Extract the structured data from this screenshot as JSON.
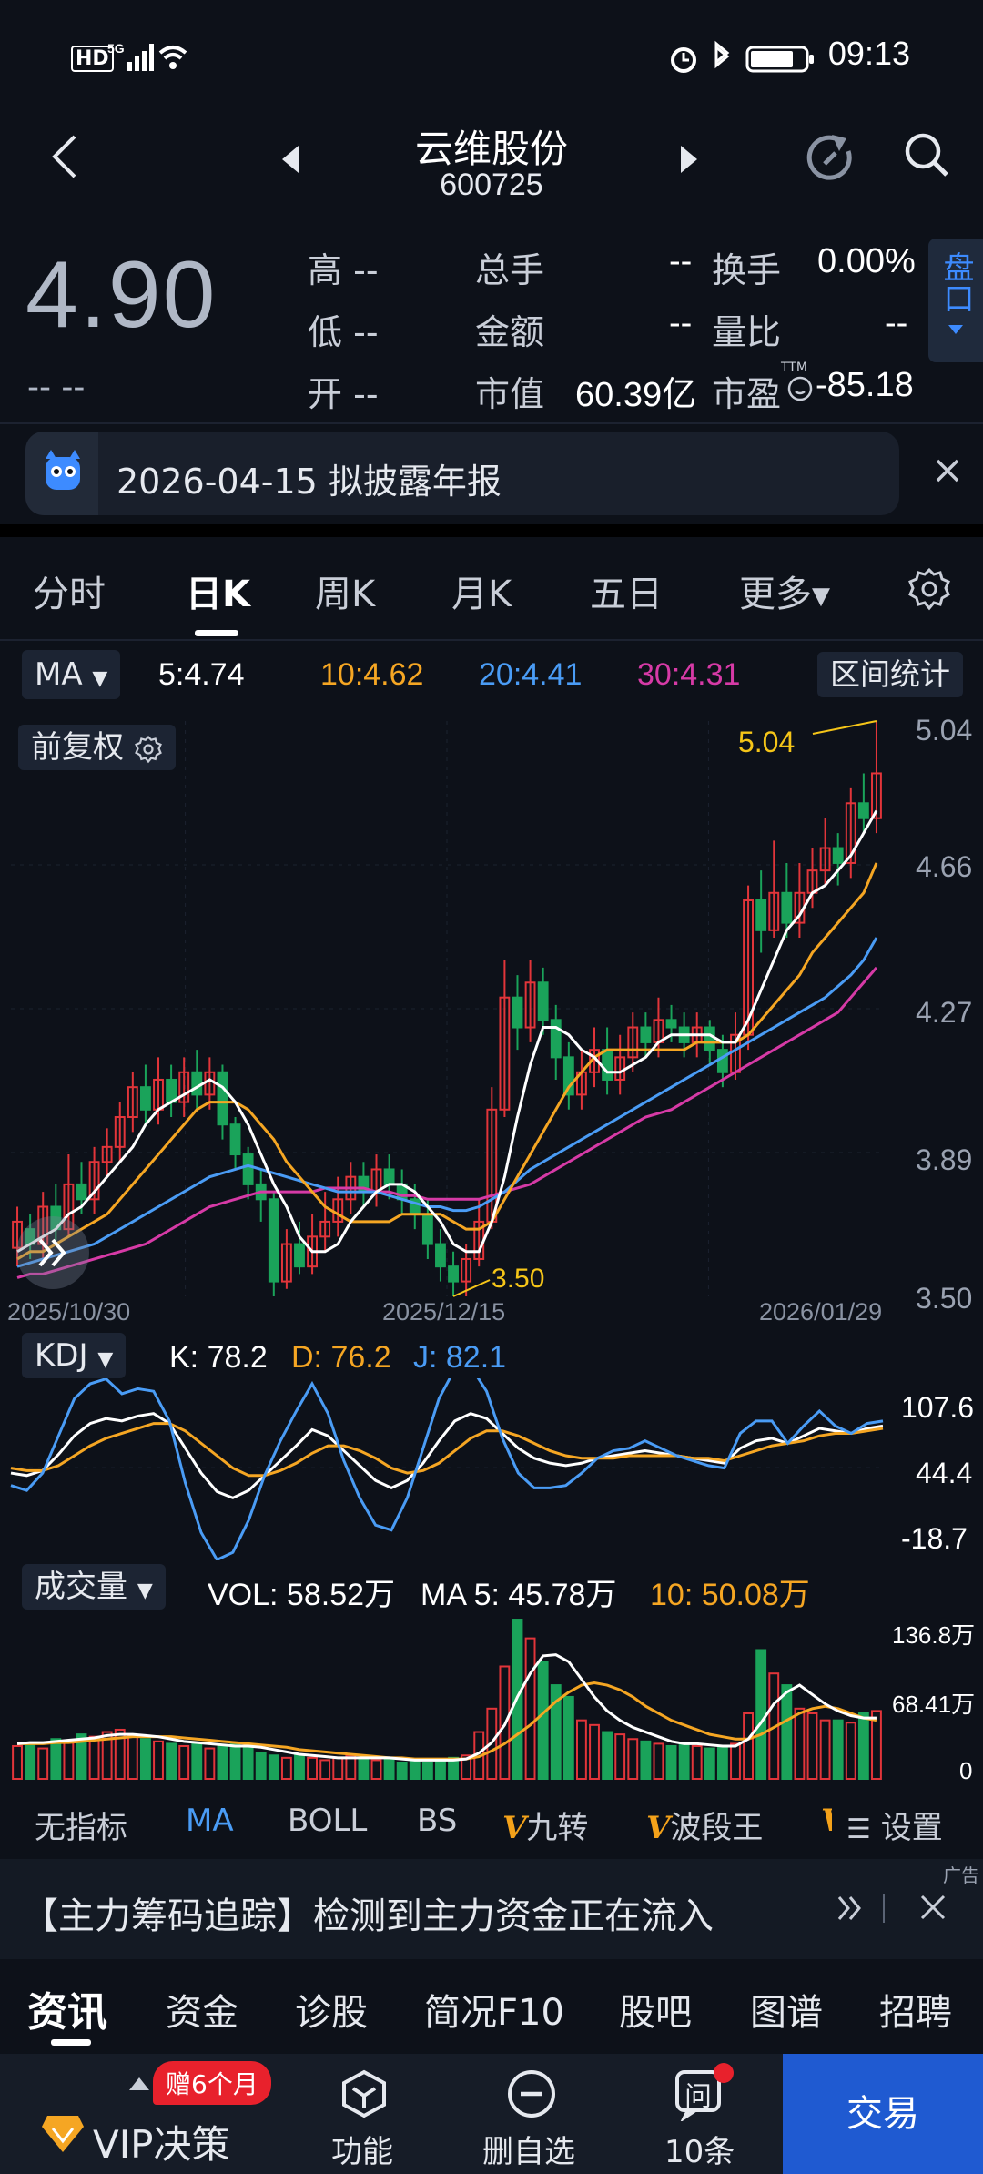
{
  "status": {
    "time": "09:13",
    "hd": "HD",
    "net": "5G"
  },
  "header": {
    "stock_name": "云维股份",
    "stock_code": "600725"
  },
  "quote": {
    "price": "4.90",
    "change": "-- --",
    "high_label": "高",
    "high": "--",
    "low_label": "低",
    "low": "--",
    "open_label": "开",
    "open": "--",
    "vol_label": "总手",
    "vol": "--",
    "amount_label": "金额",
    "amount": "--",
    "mcap_label": "市值",
    "mcap": "60.39亿",
    "turnover_label": "换手",
    "turnover": "0.00%",
    "ratio_label": "量比",
    "ratio": "--",
    "pe_label": "市盈",
    "pe_sup": "TTM",
    "pe": "-85.18",
    "pankou": "盘口"
  },
  "notice": {
    "text": "2026-04-15 拟披露年报"
  },
  "period_tabs": [
    "分时",
    "日K",
    "周K",
    "月K",
    "五日",
    "更多"
  ],
  "ma_bar": {
    "selector": "MA",
    "ma5": "5:4.74",
    "ma10": "10:4.62",
    "ma20": "20:4.41",
    "ma30": "30:4.31",
    "range_btn": "区间统计"
  },
  "adjust_btn": "前复权",
  "colors": {
    "up": "#e2353a",
    "down": "#1aa35a",
    "ma5": "#ffffff",
    "ma10": "#f5a623",
    "ma20": "#4a9cf5",
    "ma30": "#d63aa6",
    "accent": "#1f5ad1"
  },
  "chart_data": [
    {
      "type": "candlestick",
      "y_ticks": [
        "5.04",
        "4.66",
        "4.27",
        "3.89",
        "3.50"
      ],
      "ylim": [
        3.5,
        5.04
      ],
      "x_ticks": [
        "2025/10/30",
        "2025/12/15",
        "2026/01/29"
      ],
      "annotations": {
        "max": "5.04",
        "min": "3.50"
      },
      "candles": [
        [
          3.63,
          3.7,
          3.58,
          3.74
        ],
        [
          3.68,
          3.64,
          3.6,
          3.72
        ],
        [
          3.64,
          3.74,
          3.6,
          3.78
        ],
        [
          3.74,
          3.68,
          3.65,
          3.8
        ],
        [
          3.68,
          3.8,
          3.66,
          3.88
        ],
        [
          3.8,
          3.76,
          3.72,
          3.86
        ],
        [
          3.76,
          3.86,
          3.72,
          3.9
        ],
        [
          3.86,
          3.9,
          3.82,
          3.95
        ],
        [
          3.9,
          3.98,
          3.86,
          4.02
        ],
        [
          3.98,
          4.06,
          3.94,
          4.1
        ],
        [
          4.06,
          4.0,
          3.96,
          4.12
        ],
        [
          4.0,
          4.08,
          3.96,
          4.14
        ],
        [
          4.08,
          4.02,
          3.98,
          4.12
        ],
        [
          4.02,
          4.1,
          3.98,
          4.14
        ],
        [
          4.1,
          4.04,
          4.0,
          4.16
        ],
        [
          4.04,
          4.1,
          4.0,
          4.14
        ],
        [
          4.1,
          3.96,
          3.92,
          4.12
        ],
        [
          3.96,
          3.88,
          3.84,
          3.98
        ],
        [
          3.88,
          3.8,
          3.76,
          3.9
        ],
        [
          3.8,
          3.76,
          3.7,
          3.84
        ],
        [
          3.76,
          3.54,
          3.5,
          3.78
        ],
        [
          3.54,
          3.64,
          3.52,
          3.68
        ],
        [
          3.64,
          3.58,
          3.56,
          3.7
        ],
        [
          3.58,
          3.66,
          3.56,
          3.72
        ],
        [
          3.66,
          3.7,
          3.62,
          3.78
        ],
        [
          3.7,
          3.76,
          3.66,
          3.82
        ],
        [
          3.76,
          3.82,
          3.72,
          3.86
        ],
        [
          3.82,
          3.78,
          3.74,
          3.86
        ],
        [
          3.78,
          3.84,
          3.74,
          3.88
        ],
        [
          3.84,
          3.8,
          3.76,
          3.88
        ],
        [
          3.8,
          3.76,
          3.72,
          3.84
        ],
        [
          3.76,
          3.72,
          3.68,
          3.8
        ],
        [
          3.72,
          3.64,
          3.6,
          3.76
        ],
        [
          3.64,
          3.58,
          3.54,
          3.68
        ],
        [
          3.58,
          3.54,
          3.5,
          3.62
        ],
        [
          3.54,
          3.6,
          3.5,
          3.64
        ],
        [
          3.6,
          3.7,
          3.58,
          3.76
        ],
        [
          3.7,
          4.0,
          3.68,
          4.06
        ],
        [
          4.0,
          4.3,
          3.98,
          4.4
        ],
        [
          4.3,
          4.22,
          4.16,
          4.36
        ],
        [
          4.22,
          4.34,
          4.18,
          4.4
        ],
        [
          4.34,
          4.24,
          4.2,
          4.38
        ],
        [
          4.24,
          4.14,
          4.08,
          4.28
        ],
        [
          4.14,
          4.04,
          4.0,
          4.18
        ],
        [
          4.04,
          4.1,
          4.0,
          4.16
        ],
        [
          4.1,
          4.16,
          4.06,
          4.22
        ],
        [
          4.16,
          4.08,
          4.04,
          4.22
        ],
        [
          4.08,
          4.14,
          4.04,
          4.2
        ],
        [
          4.14,
          4.22,
          4.1,
          4.26
        ],
        [
          4.22,
          4.18,
          4.14,
          4.26
        ],
        [
          4.18,
          4.24,
          4.14,
          4.3
        ],
        [
          4.24,
          4.22,
          4.18,
          4.28
        ],
        [
          4.22,
          4.18,
          4.14,
          4.26
        ],
        [
          4.18,
          4.22,
          4.14,
          4.26
        ],
        [
          4.22,
          4.16,
          4.12,
          4.24
        ],
        [
          4.16,
          4.1,
          4.06,
          4.2
        ],
        [
          4.1,
          4.2,
          4.08,
          4.26
        ],
        [
          4.2,
          4.56,
          4.16,
          4.6
        ],
        [
          4.56,
          4.48,
          4.42,
          4.64
        ],
        [
          4.48,
          4.58,
          4.46,
          4.72
        ],
        [
          4.58,
          4.5,
          4.46,
          4.66
        ],
        [
          4.5,
          4.58,
          4.46,
          4.66
        ],
        [
          4.58,
          4.64,
          4.54,
          4.7
        ],
        [
          4.64,
          4.7,
          4.6,
          4.78
        ],
        [
          4.7,
          4.66,
          4.6,
          4.74
        ],
        [
          4.66,
          4.82,
          4.62,
          4.86
        ],
        [
          4.82,
          4.78,
          4.74,
          4.9
        ],
        [
          4.78,
          4.9,
          4.74,
          5.04
        ]
      ],
      "ma5": [
        3.62,
        3.64,
        3.66,
        3.68,
        3.72,
        3.74,
        3.78,
        3.82,
        3.86,
        3.9,
        3.96,
        4.0,
        4.02,
        4.04,
        4.06,
        4.08,
        4.06,
        4.02,
        3.96,
        3.88,
        3.8,
        3.74,
        3.66,
        3.62,
        3.62,
        3.64,
        3.7,
        3.74,
        3.78,
        3.8,
        3.8,
        3.78,
        3.74,
        3.7,
        3.64,
        3.62,
        3.62,
        3.7,
        3.82,
        3.98,
        4.12,
        4.22,
        4.22,
        4.2,
        4.16,
        4.14,
        4.1,
        4.1,
        4.12,
        4.14,
        4.18,
        4.2,
        4.2,
        4.2,
        4.2,
        4.18,
        4.18,
        4.24,
        4.32,
        4.4,
        4.48,
        4.52,
        4.58,
        4.6,
        4.64,
        4.68,
        4.74,
        4.8
      ],
      "ma10": [
        3.6,
        3.62,
        3.62,
        3.64,
        3.66,
        3.68,
        3.7,
        3.72,
        3.76,
        3.8,
        3.84,
        3.88,
        3.92,
        3.96,
        4.0,
        4.02,
        4.02,
        4.02,
        4.0,
        3.96,
        3.92,
        3.86,
        3.82,
        3.78,
        3.74,
        3.72,
        3.7,
        3.7,
        3.7,
        3.7,
        3.72,
        3.72,
        3.72,
        3.72,
        3.7,
        3.68,
        3.68,
        3.7,
        3.76,
        3.82,
        3.88,
        3.94,
        4.0,
        4.06,
        4.1,
        4.14,
        4.16,
        4.16,
        4.16,
        4.16,
        4.16,
        4.16,
        4.16,
        4.18,
        4.18,
        4.18,
        4.18,
        4.2,
        4.24,
        4.28,
        4.32,
        4.36,
        4.42,
        4.46,
        4.5,
        4.54,
        4.58,
        4.66
      ],
      "ma20": [
        3.58,
        3.59,
        3.6,
        3.61,
        3.62,
        3.63,
        3.64,
        3.66,
        3.68,
        3.7,
        3.72,
        3.74,
        3.76,
        3.78,
        3.8,
        3.82,
        3.83,
        3.84,
        3.85,
        3.84,
        3.83,
        3.82,
        3.81,
        3.8,
        3.79,
        3.78,
        3.78,
        3.78,
        3.78,
        3.77,
        3.76,
        3.75,
        3.74,
        3.74,
        3.73,
        3.73,
        3.74,
        3.76,
        3.78,
        3.81,
        3.84,
        3.86,
        3.88,
        3.9,
        3.92,
        3.94,
        3.96,
        3.98,
        4.0,
        4.02,
        4.04,
        4.06,
        4.08,
        4.1,
        4.12,
        4.14,
        4.16,
        4.18,
        4.2,
        4.22,
        4.24,
        4.26,
        4.28,
        4.3,
        4.33,
        4.36,
        4.4,
        4.46
      ],
      "ma30": [
        3.55,
        3.56,
        3.56,
        3.57,
        3.58,
        3.59,
        3.6,
        3.61,
        3.62,
        3.63,
        3.64,
        3.66,
        3.68,
        3.7,
        3.72,
        3.74,
        3.75,
        3.76,
        3.77,
        3.78,
        3.78,
        3.78,
        3.78,
        3.78,
        3.79,
        3.79,
        3.79,
        3.79,
        3.78,
        3.78,
        3.77,
        3.77,
        3.76,
        3.76,
        3.76,
        3.76,
        3.76,
        3.77,
        3.78,
        3.79,
        3.8,
        3.82,
        3.84,
        3.86,
        3.88,
        3.9,
        3.92,
        3.94,
        3.96,
        3.98,
        3.99,
        4.0,
        4.02,
        4.04,
        4.06,
        4.08,
        4.1,
        4.12,
        4.14,
        4.16,
        4.18,
        4.2,
        4.22,
        4.24,
        4.26,
        4.3,
        4.34,
        4.38
      ]
    },
    {
      "type": "line",
      "name": "KDJ",
      "y_ticks": [
        "107.6",
        "44.4",
        "-18.7"
      ],
      "ylim": [
        -18.7,
        107.6
      ],
      "legend": {
        "k": "K: 78.2",
        "d": "D: 76.2",
        "j": "J: 82.1"
      },
      "series": [
        {
          "name": "K",
          "values": [
            40,
            38,
            42,
            55,
            70,
            80,
            84,
            82,
            86,
            88,
            80,
            60,
            40,
            25,
            20,
            26,
            38,
            50,
            62,
            75,
            70,
            58,
            46,
            34,
            28,
            34,
            48,
            66,
            82,
            88,
            84,
            72,
            60,
            52,
            48,
            46,
            48,
            52,
            54,
            56,
            58,
            56,
            54,
            52,
            50,
            48,
            60,
            66,
            68,
            64,
            70,
            76,
            74,
            72,
            76,
            78
          ]
        },
        {
          "name": "D",
          "values": [
            44,
            42,
            42,
            46,
            54,
            62,
            68,
            72,
            76,
            80,
            80,
            74,
            64,
            54,
            44,
            38,
            38,
            42,
            48,
            56,
            62,
            62,
            58,
            52,
            44,
            40,
            42,
            48,
            58,
            68,
            74,
            74,
            70,
            64,
            58,
            54,
            52,
            52,
            52,
            54,
            54,
            54,
            54,
            52,
            52,
            50,
            54,
            58,
            62,
            64,
            66,
            70,
            72,
            72,
            74,
            76
          ]
        },
        {
          "name": "J",
          "values": [
            30,
            26,
            40,
            70,
            100,
            112,
            116,
            104,
            108,
            106,
            82,
            32,
            -8,
            -30,
            -24,
            2,
            38,
            66,
            90,
            112,
            88,
            50,
            20,
            -2,
            -6,
            20,
            60,
            100,
            124,
            126,
            106,
            68,
            40,
            28,
            28,
            30,
            40,
            52,
            58,
            60,
            66,
            60,
            54,
            50,
            46,
            44,
            72,
            82,
            82,
            64,
            78,
            90,
            78,
            72,
            80,
            82
          ]
        }
      ]
    },
    {
      "type": "bar",
      "name": "成交量",
      "y_ticks": [
        "136.8万",
        "68.41万",
        "0"
      ],
      "ylim": [
        0,
        136.8
      ],
      "legend": {
        "vol": "VOL: 58.52万",
        "ma5": "MA 5: 45.78万",
        "ma10": "10: 50.08万"
      },
      "values": [
        28,
        30,
        26,
        34,
        32,
        38,
        36,
        40,
        42,
        36,
        34,
        32,
        30,
        28,
        30,
        26,
        28,
        30,
        26,
        22,
        20,
        18,
        20,
        18,
        16,
        18,
        20,
        18,
        16,
        18,
        14,
        16,
        14,
        16,
        18,
        20,
        40,
        60,
        96,
        136,
        120,
        100,
        80,
        70,
        50,
        46,
        40,
        38,
        34,
        32,
        30,
        28,
        30,
        28,
        26,
        28,
        30,
        56,
        110,
        90,
        80,
        60,
        56,
        50,
        50,
        48,
        56,
        58
      ],
      "ma5": [
        30,
        31,
        31,
        32,
        33,
        34,
        35,
        37,
        38,
        38,
        37,
        36,
        34,
        32,
        31,
        30,
        29,
        28,
        28,
        27,
        25,
        23,
        21,
        20,
        19,
        18,
        18,
        18,
        18,
        18,
        17,
        16,
        16,
        16,
        16,
        17,
        22,
        31,
        46,
        70,
        90,
        105,
        106,
        100,
        85,
        70,
        58,
        50,
        44,
        40,
        36,
        32,
        30,
        30,
        29,
        28,
        28,
        34,
        48,
        64,
        74,
        80,
        72,
        64,
        58,
        54,
        52,
        52
      ],
      "ma10": [
        30,
        30,
        30,
        31,
        31,
        32,
        33,
        34,
        35,
        36,
        36,
        36,
        36,
        35,
        34,
        33,
        32,
        31,
        30,
        29,
        28,
        27,
        25,
        24,
        23,
        22,
        21,
        20,
        19,
        18,
        18,
        17,
        17,
        17,
        17,
        17,
        19,
        24,
        30,
        38,
        46,
        56,
        66,
        74,
        80,
        82,
        80,
        76,
        70,
        62,
        56,
        50,
        46,
        42,
        38,
        36,
        34,
        34,
        38,
        44,
        50,
        56,
        60,
        62,
        60,
        56,
        52,
        50
      ],
      "up": [
        1,
        0,
        1,
        0,
        1,
        0,
        1,
        1,
        1,
        1,
        0,
        1,
        0,
        1,
        0,
        1,
        0,
        0,
        0,
        0,
        0,
        1,
        0,
        1,
        1,
        1,
        1,
        0,
        1,
        0,
        0,
        0,
        0,
        0,
        0,
        1,
        1,
        1,
        1,
        0,
        1,
        0,
        0,
        0,
        1,
        1,
        0,
        1,
        1,
        0,
        1,
        0,
        0,
        1,
        0,
        0,
        1,
        1,
        0,
        1,
        0,
        1,
        1,
        1,
        0,
        1,
        0,
        1
      ]
    }
  ],
  "kdj_selector": "KDJ",
  "vol_selector": "成交量",
  "indicator_tabs": {
    "none": "无指标",
    "ma": "MA",
    "boll": "BOLL",
    "bs": "BS",
    "jiuzhuan": "九转",
    "boduan": "波段王",
    "v_mark": "V",
    "settings": "设置"
  },
  "ad": {
    "text": "【主力筹码追踪】检测到主力资金正在流入",
    "tag": "广告"
  },
  "info_tabs": [
    "资讯",
    "资金",
    "诊股",
    "简况F10",
    "股吧",
    "图谱",
    "招聘"
  ],
  "bottom_nav": {
    "vip": "VIP决策",
    "gift": "赠6个月",
    "func": "功能",
    "delete": "删自选",
    "ask": "问",
    "count": "10条",
    "trade": "交易"
  }
}
